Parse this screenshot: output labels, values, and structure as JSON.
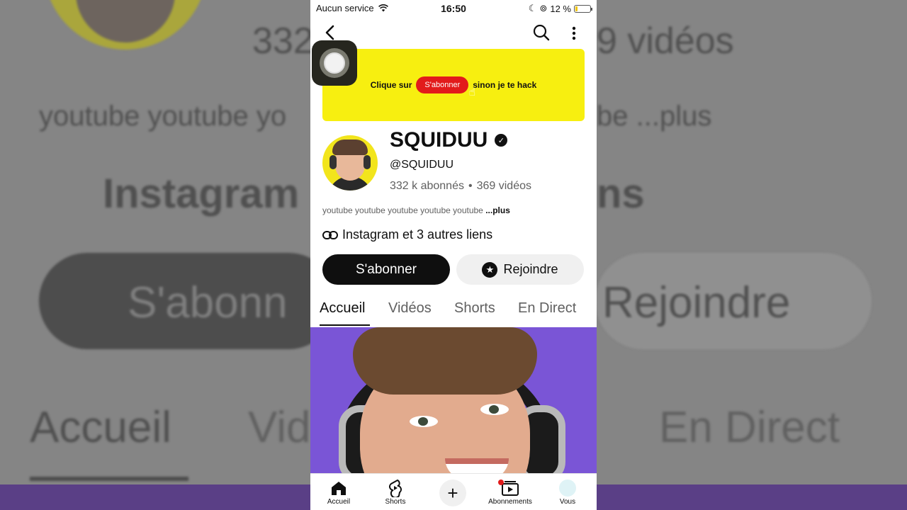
{
  "status_bar": {
    "carrier": "Aucun service",
    "time": "16:50",
    "battery": "12 %"
  },
  "background": {
    "big_count": "332",
    "big_videos": "9 vidéos",
    "big_desc": "youtube youtube yo",
    "big_desc_right": "be ...plus",
    "big_links": "Instagram",
    "big_links_right": "ns",
    "big_subscribe": "S'abonn",
    "big_join": "Rejoindre",
    "big_tab_home": "Accueil",
    "big_tab_videos": "Vid",
    "big_tab_live": "En Direct"
  },
  "banner": {
    "text_before": "Clique sur",
    "pill": "S'abonner",
    "text_after": "sinon je te hack"
  },
  "channel": {
    "name": "SQUIDUU",
    "handle": "@SQUIDUU",
    "subscribers": "332 k abonnés",
    "separator": "•",
    "videos": "369 vidéos",
    "description": "youtube youtube youtube youtube youtube",
    "more": "...plus",
    "links": "Instagram et 3 autres liens"
  },
  "actions": {
    "subscribe": "S'abonner",
    "join": "Rejoindre"
  },
  "tabs": [
    {
      "label": "Accueil",
      "active": true
    },
    {
      "label": "Vidéos",
      "active": false
    },
    {
      "label": "Shorts",
      "active": false
    },
    {
      "label": "En Direct",
      "active": false
    }
  ],
  "bottom_nav": {
    "home": "Accueil",
    "shorts": "Shorts",
    "subscriptions": "Abonnements",
    "you": "Vous"
  },
  "colors": {
    "banner_yellow": "#f7ef10",
    "subscribe_red": "#e21b1b",
    "hero_purple": "#7a55d6"
  }
}
